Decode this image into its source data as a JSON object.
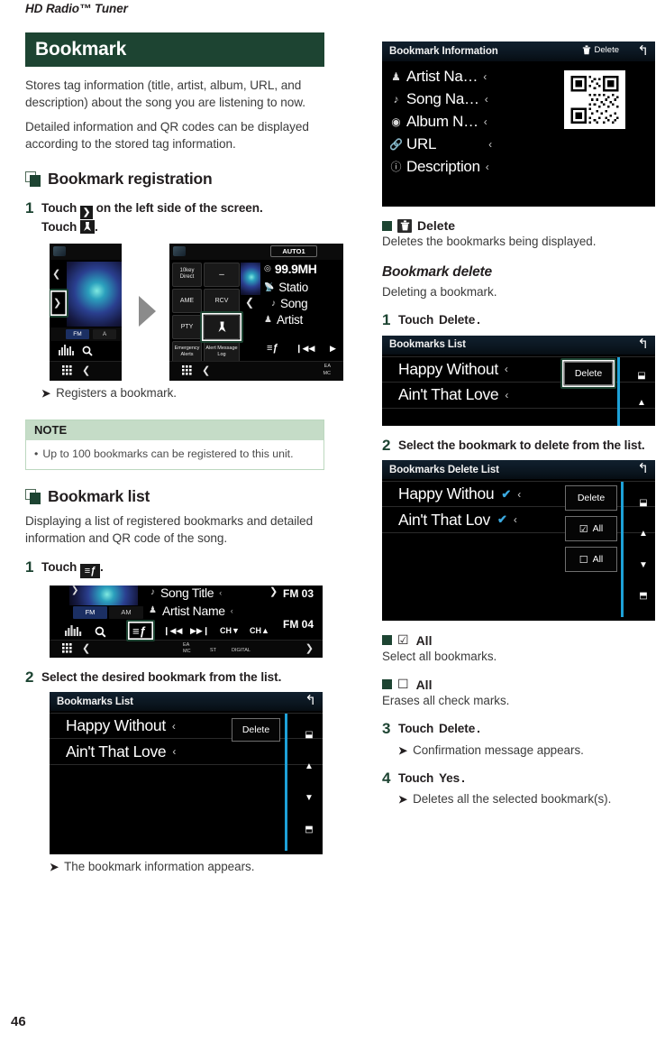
{
  "running_head": "HD Radio™ Tuner",
  "page_number": "46",
  "chapter": {
    "title": "Bookmark"
  },
  "intro": {
    "paragraph_1": "Stores tag information (title, artist, album, URL, and description) about the song you are listening to now.",
    "paragraph_2": "Detailed information and QR codes can be displayed according to the stored tag information."
  },
  "registration": {
    "heading": "Bookmark registration",
    "step1": {
      "number": "1",
      "text_before": "Touch",
      "text_middle": "on the left side of the screen.",
      "text_touch2": "Touch",
      "text_end": "."
    },
    "result": "Registers a bookmark.",
    "note": {
      "title": "NOTE",
      "items": [
        "Up to 100 bookmarks can be registered to this unit."
      ]
    }
  },
  "bookmark_list": {
    "heading": "Bookmark list",
    "description": "Displaying a list of registered bookmarks and detailed information and QR code of the song.",
    "step1": {
      "number": "1",
      "text": "Touch",
      "text_end": "."
    },
    "step2": {
      "number": "2",
      "text": "Select the desired bookmark from the list."
    },
    "result": "The bookmark information appears."
  },
  "delete_bullet": {
    "label": "Delete",
    "description": "Deletes the bookmarks being displayed."
  },
  "bookmark_delete": {
    "heading": "Bookmark delete",
    "description": "Deleting a bookmark.",
    "step1": {
      "number": "1",
      "text": "Touch",
      "key": "Delete",
      "text_end": "."
    },
    "step2": {
      "number": "2",
      "text": "Select the bookmark to delete from the list."
    },
    "bullet_check_all": {
      "glyph": "☑",
      "label": "All",
      "description": "Select all bookmarks."
    },
    "bullet_uncheck_all": {
      "glyph": "☐",
      "label": "All",
      "description": "Erases all check marks."
    },
    "step3": {
      "number": "3",
      "text": "Touch",
      "key": "Delete",
      "text_end": "."
    },
    "step3_result": "Confirmation message appears.",
    "step4": {
      "number": "4",
      "text": "Touch",
      "key": "Yes",
      "text_end": "."
    },
    "step4_result": "Deletes all the selected bookmark(s)."
  },
  "screens": {
    "radio_left": {
      "chevron_left": "❮",
      "chevron_right": "❯",
      "band_fm": "FM",
      "band_am": "A",
      "search_icon": "search-icon",
      "eq_icon": "equalizer-icon"
    },
    "radio_right": {
      "auto_label": "AUTO1",
      "btn_10key": "10key Direct",
      "btn_dash": "–",
      "btn_ame": "AME",
      "btn_rcv": "RCV",
      "btn_pty": "PTY",
      "btn_emergency": "Emergency Alerts",
      "btn_alert_log": "Alert Message Log",
      "frequency": "99.9MH",
      "station": "Statio",
      "song": "Song",
      "artist": "Artist",
      "ea": "EA",
      "mc": "MC"
    },
    "radio_wide": {
      "song_title": "Song Title",
      "artist_name": "Artist Name",
      "band_fm": "FM",
      "band_am": "AM",
      "ch_down": "CH▼",
      "ch_up": "CH▲",
      "preset_3": "FM 03",
      "preset_4": "FM 04",
      "ea": "EA",
      "mc": "MC",
      "st": "ST",
      "digital": "DIGITAL"
    },
    "bookmarks_list": {
      "title": "Bookmarks List",
      "back_icon": "back-arrow-icon",
      "rows": [
        {
          "song": "Happy Without",
          "chevron": "‹"
        },
        {
          "song": "Ain't That Love",
          "chevron": "‹"
        }
      ],
      "delete_button": "Delete"
    },
    "bookmark_information": {
      "title": "Bookmark Information",
      "delete_button": "Delete",
      "back_icon": "back-arrow-icon",
      "rows": [
        {
          "icon": "artist-icon",
          "label": "Artist Na…",
          "chevron": "‹"
        },
        {
          "icon": "note-icon",
          "label": "Song Na…",
          "chevron": "‹"
        },
        {
          "icon": "album-icon",
          "label": "Album N…",
          "chevron": "‹"
        },
        {
          "icon": "link-icon",
          "label": "URL",
          "chevron": "‹"
        },
        {
          "icon": "info-icon",
          "label": "Description",
          "chevron": "‹"
        }
      ]
    },
    "bookmarks_delete_list": {
      "title": "Bookmarks Delete List",
      "back_icon": "back-arrow-icon",
      "rows": [
        {
          "song": "Happy Withou",
          "check": "✔",
          "chevron": "‹"
        },
        {
          "song": "Ain't That Lov",
          "check": "✔",
          "chevron": "‹"
        }
      ],
      "delete_button": "Delete",
      "check_all_button": "All",
      "uncheck_all_button": "All"
    }
  },
  "colors": {
    "brand_green": "#1d4432",
    "note_green": "#c5dcc7",
    "note_border": "#bcd8bf",
    "screen_blue": "#1da1d8"
  }
}
